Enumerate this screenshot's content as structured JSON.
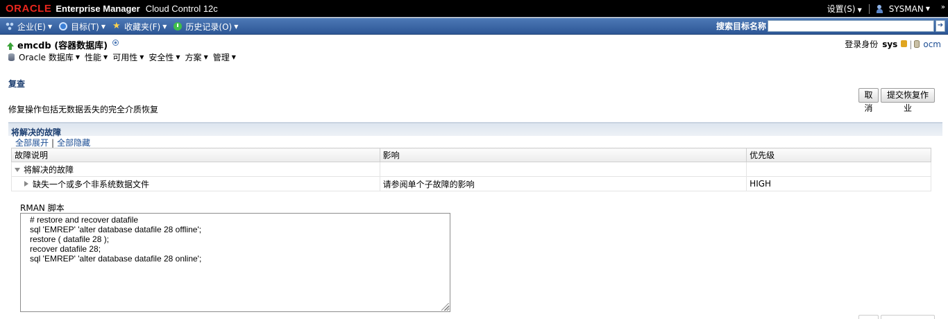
{
  "topbar": {
    "oracle": "ORACLE",
    "product": "Enterprise Manager",
    "edition": "Cloud Control 12c",
    "settings": "设置(S)",
    "user": "SYSMAN",
    "more": "»"
  },
  "menubar": {
    "items": [
      {
        "label": "企业(E)",
        "icon": "enterprise-icon"
      },
      {
        "label": "目标(T)",
        "icon": "target-icon"
      },
      {
        "label": "收藏夹(F)",
        "icon": "star-icon"
      },
      {
        "label": "历史记录(O)",
        "icon": "history-icon"
      }
    ],
    "search_label": "搜索目标名称",
    "search_value": ""
  },
  "target": {
    "name": "emcdb (容器数据库)",
    "login_label": "登录身份",
    "login_user": "sys",
    "host": "ocm"
  },
  "target_menu": [
    "Oracle 数据库",
    "性能",
    "可用性",
    "安全性",
    "方案",
    "管理"
  ],
  "review": {
    "title": "复查",
    "cancel": "取消",
    "submit": "提交恢复作业",
    "description": "修复操作包括无数据丢失的完全介质恢复"
  },
  "failures": {
    "title": "将解决的故障",
    "expand_all": "全部展开",
    "collapse_all": "全部隐藏",
    "columns": [
      "故障说明",
      "影响",
      "优先级"
    ],
    "rows": [
      {
        "desc": "将解决的故障",
        "impact": "",
        "priority": ""
      },
      {
        "desc": "缺失一个或多个非系统数据文件",
        "impact": "请参阅单个子故障的影响",
        "priority": "HIGH"
      }
    ]
  },
  "rman": {
    "label": "RMAN 脚本",
    "script": "# restore and recover datafile\nsql 'EMREP' 'alter database datafile 28 offline';\nrestore ( datafile 28 );\nrecover datafile 28;\nsql 'EMREP' 'alter database datafile 28 online';"
  }
}
